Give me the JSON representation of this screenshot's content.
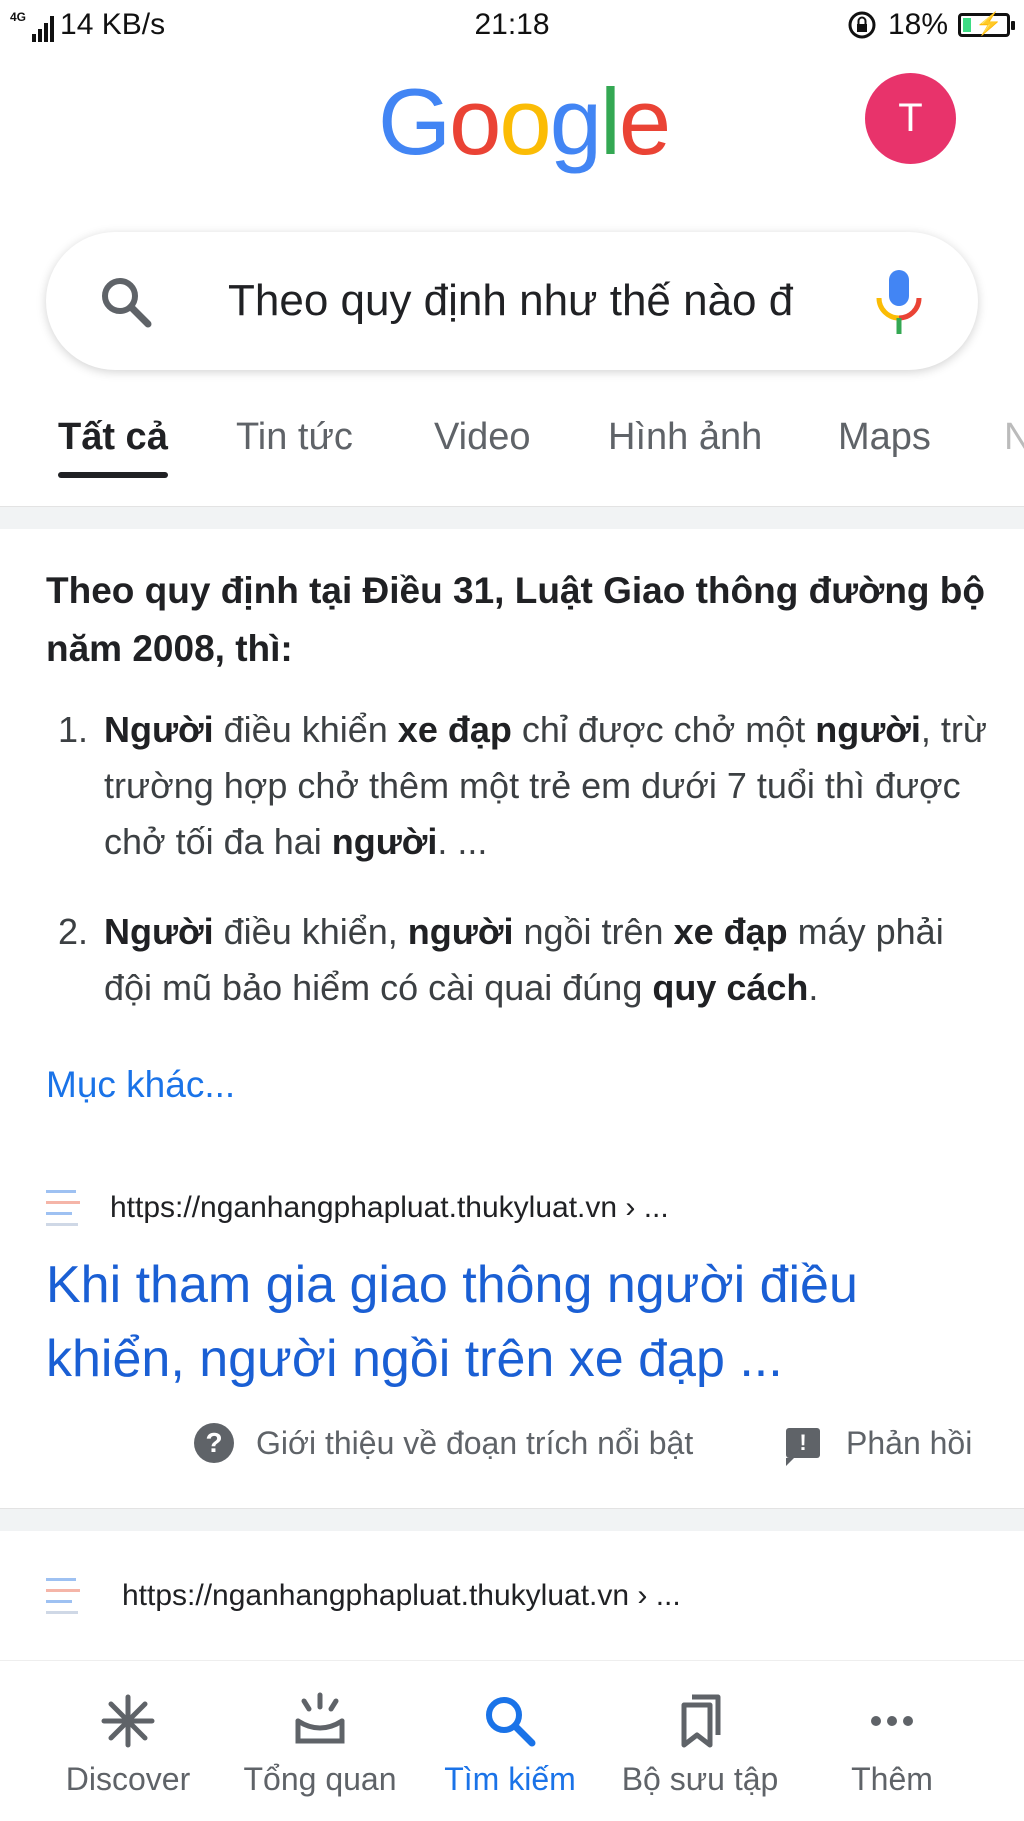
{
  "status_bar": {
    "network": "4G",
    "speed": "14 KB/s",
    "time": "21:18",
    "battery_percent": "18%",
    "battery_level": 0.18,
    "battery_color": "#3ddc84"
  },
  "header": {
    "logo_letters": [
      "G",
      "o",
      "o",
      "g",
      "l",
      "e"
    ],
    "logo_colors": [
      "#4285F4",
      "#EA4335",
      "#FBBC05",
      "#4285F4",
      "#34A853",
      "#EA4335"
    ],
    "avatar_initial": "T",
    "avatar_color": "#e8336b"
  },
  "search": {
    "query": "Theo quy định như thế nào đ",
    "search_icon": "search-icon",
    "mic_icon": "mic-icon"
  },
  "tabs": [
    {
      "label": "Tất cả",
      "active": true
    },
    {
      "label": "Tin tức",
      "active": false
    },
    {
      "label": "Video",
      "active": false
    },
    {
      "label": "Hình ảnh",
      "active": false
    },
    {
      "label": "Maps",
      "active": false
    },
    {
      "label": "N",
      "active": false
    }
  ],
  "featured_snippet": {
    "heading": "Theo quy định tại Điều 31, Luật Giao thông đường bộ năm 2008, thì:",
    "items": [
      {
        "num": "1.",
        "parts": [
          {
            "t": "Người",
            "b": true
          },
          {
            "t": " điều khiển ",
            "b": false
          },
          {
            "t": "xe đạp",
            "b": true
          },
          {
            "t": " chỉ được chở một ",
            "b": false
          },
          {
            "t": "người",
            "b": true
          },
          {
            "t": ", trừ trường hợp chở thêm một trẻ em dưới 7 tuổi thì được chở tối đa hai ",
            "b": false
          },
          {
            "t": "người",
            "b": true
          },
          {
            "t": ". ...",
            "b": false
          }
        ]
      },
      {
        "num": "2.",
        "parts": [
          {
            "t": "Người",
            "b": true
          },
          {
            "t": " điều khiển, ",
            "b": false
          },
          {
            "t": "người",
            "b": true
          },
          {
            "t": " ngồi trên ",
            "b": false
          },
          {
            "t": "xe đạp",
            "b": true
          },
          {
            "t": " máy phải đội mũ bảo hiểm có cài quai đúng ",
            "b": false
          },
          {
            "t": "quy cách",
            "b": true
          },
          {
            "t": ".",
            "b": false
          }
        ]
      }
    ],
    "more_link": "Mục khác...",
    "source_url": "https://nganhangphapluat.thukyluat.vn › ...",
    "source_title": "Khi tham gia giao thông người điều khiển, người ngồi trên xe đạp ...",
    "about_label": "Giới thiệu về đoạn trích nổi bật",
    "feedback_label": "Phản hồi"
  },
  "second_result": {
    "source_url": "https://nganhangphapluat.thukyluat.vn › ..."
  },
  "bottom_nav": [
    {
      "label": "Discover",
      "icon": "asterisk-icon",
      "active": false
    },
    {
      "label": "Tổng quan",
      "icon": "overview-icon",
      "active": false
    },
    {
      "label": "Tìm kiếm",
      "icon": "search-icon",
      "active": true
    },
    {
      "label": "Bộ sưu tập",
      "icon": "collections-icon",
      "active": false
    },
    {
      "label": "Thêm",
      "icon": "more-icon",
      "active": false
    }
  ]
}
